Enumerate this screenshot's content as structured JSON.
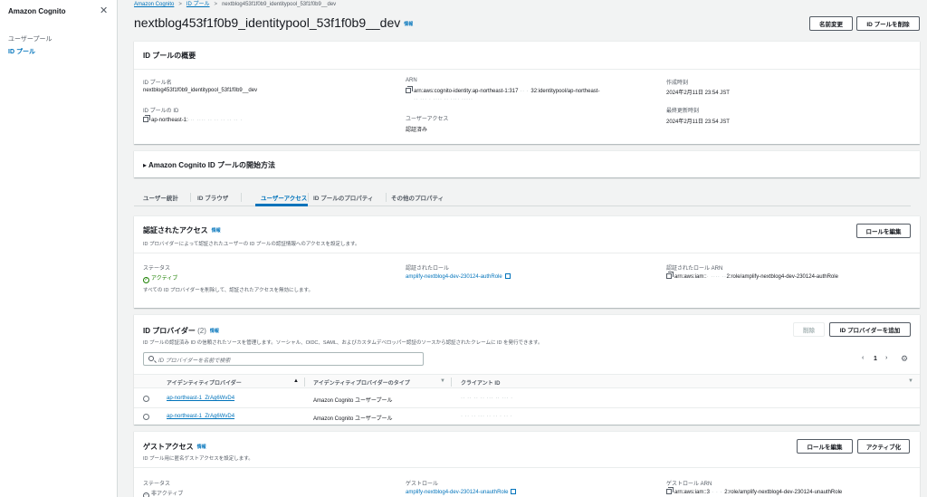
{
  "sidebar": {
    "title": "Amazon Cognito",
    "items": [
      {
        "label": "ユーザープール"
      },
      {
        "label": "ID プール"
      }
    ]
  },
  "breadcrumb": {
    "items": [
      "Amazon Cognito",
      "ID プール",
      "nextblog453f1f0b9_identitypool_53f1f0b9__dev"
    ]
  },
  "header": {
    "title": "nextblog453f1f0b9_identitypool_53f1f0b9__dev",
    "info": "情報",
    "rename_label": "名前変更",
    "delete_label": "ID プールを削除"
  },
  "overview": {
    "title": "ID プールの概要",
    "pool_name_label": "ID プール名",
    "pool_name_value": "nextblog453f1f0b9_identitypool_53f1f0b9__dev",
    "pool_id_label": "ID プールの ID",
    "pool_id_value": "ap-northeast-1:",
    "arn_label": "ARN",
    "arn_value_1": "arn:aws:cognito-identity:ap-northeast-1:317",
    "arn_value_1b": "32:identitypool/ap-northeast-",
    "user_access_label": "ユーザーアクセス",
    "user_access_value": "認証済み",
    "created_label": "作成時刻",
    "created_value": "2024年2月11日 23:54 JST",
    "updated_label": "最終更新時刻",
    "updated_value": "2024年2月11日 23:54 JST"
  },
  "getting_started": {
    "title": "Amazon Cognito ID プールの開始方法"
  },
  "tabs": [
    {
      "label": "ユーザー統計"
    },
    {
      "label": "ID ブラウザ"
    },
    {
      "label": "ユーザーアクセス"
    },
    {
      "label": "ID プールのプロパティ"
    },
    {
      "label": "その他のプロパティ"
    }
  ],
  "auth_access": {
    "title": "認証されたアクセス",
    "info": "情報",
    "desc": "ID プロバイダーによって認証されたユーザーの ID プールの認証情報へのアクセスを設定します。",
    "edit_role_label": "ロールを編集",
    "status_label": "ステータス",
    "status_value": "アクティブ",
    "status_note": "すべての ID プロバイダーを削除して、認証されたアクセスを無効にします。",
    "role_label": "認証されたロール",
    "role_value": "amplify-nextblog4-dev-230124-authRole",
    "role_arn_label": "認証されたロール ARN",
    "role_arn_prefix": "arn:aws:iam::",
    "role_arn_suffix": "2:role/amplify-nextblog4-dev-230124-authRole"
  },
  "providers": {
    "title": "ID プロバイダー",
    "count": "(2)",
    "info": "情報",
    "desc": "ID プールの認証済み ID の信頼されたソースを管理します。ソーシャル、OIDC、SAML、およびカスタムデベロッパー認証のソースから認証されたクレームに ID を発行できます。",
    "delete_label": "削除",
    "add_label": "ID プロバイダーを追加",
    "search_placeholder": "ID プロバイダーを名前で検索",
    "page": "1",
    "columns": [
      "アイデンティティプロバイダー",
      "アイデンティティプロバイダーのタイプ",
      "クライアント ID"
    ],
    "rows": [
      {
        "provider": "ap-northeast-1_ZrAg6WvD4",
        "type": "Amazon Cognito ユーザープール"
      },
      {
        "provider": "ap-northeast-1_ZrAg6WvD4",
        "type": "Amazon Cognito ユーザープール"
      }
    ]
  },
  "guest_access": {
    "title": "ゲストアクセス",
    "info": "情報",
    "desc": "ID プール用に匿名ゲストアクセスを設定します。",
    "edit_role_label": "ロールを編集",
    "activate_label": "アクティブ化",
    "status_label": "ステータス",
    "status_value": "非アクティブ",
    "role_label": "ゲストロール",
    "role_value": "amplify-nextblog4-dev-230124-unauthRole",
    "role_arn_label": "ゲストロール ARN",
    "role_arn_prefix": "arn:aws:iam::3",
    "role_arn_suffix": "2:role/amplify-nextblog4-dev-230124-unauthRole"
  },
  "colors": {
    "accent": "#0073bb",
    "success": "#1d8102",
    "background": "#f2f3f3"
  }
}
